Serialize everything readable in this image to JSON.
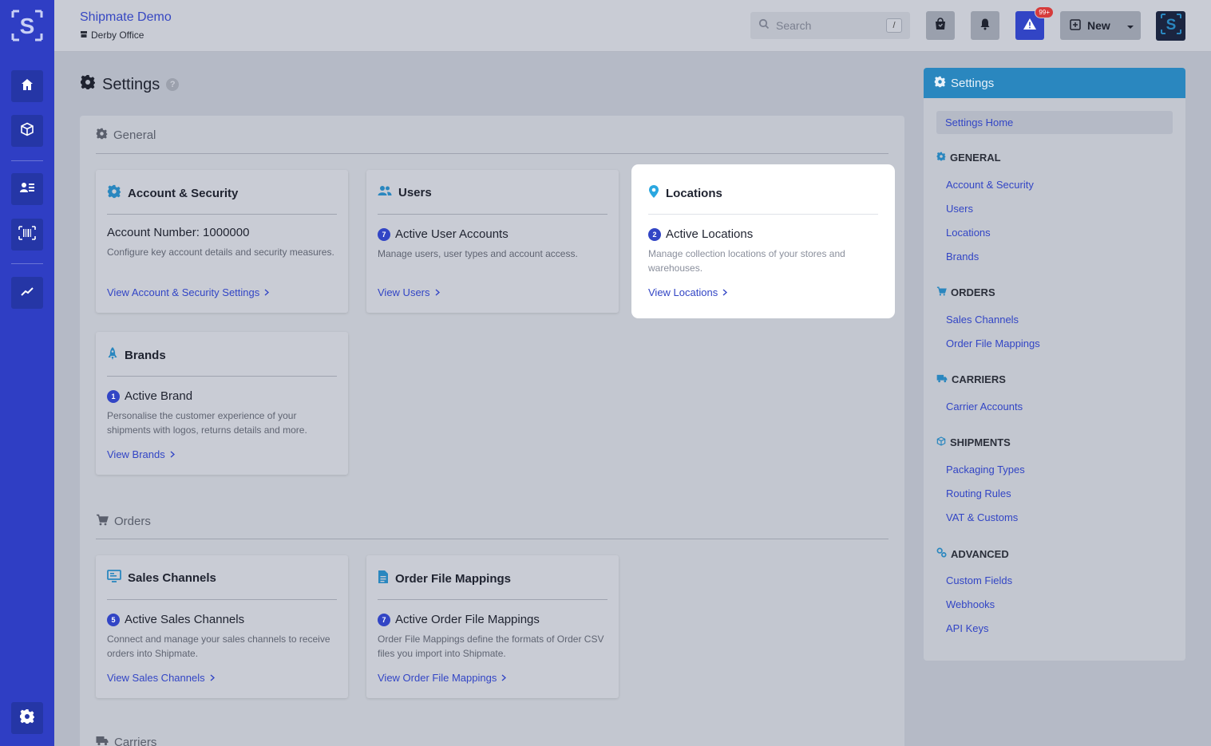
{
  "app": {
    "org_name": "Shipmate Demo",
    "office": "Derby Office"
  },
  "search": {
    "placeholder": "Search",
    "shortcut": "/"
  },
  "topbar": {
    "alerts_badge": "99+",
    "new_label": "New"
  },
  "page": {
    "title": "Settings"
  },
  "sections": {
    "general": "General",
    "orders": "Orders",
    "carriers": "Carriers"
  },
  "cards": {
    "account": {
      "title": "Account & Security",
      "subtitle": "Account Number: 1000000",
      "description": "Configure key account details and security measures.",
      "link": "View Account & Security Settings"
    },
    "users": {
      "title": "Users",
      "count": "7",
      "subtitle": "Active User Accounts",
      "description": "Manage users, user types and account access.",
      "link": "View Users"
    },
    "locations": {
      "title": "Locations",
      "count": "2",
      "subtitle": "Active Locations",
      "description": "Manage collection locations of your stores and warehouses.",
      "link": "View Locations"
    },
    "brands": {
      "title": "Brands",
      "count": "1",
      "subtitle": "Active Brand",
      "description": "Personalise the customer experience of your shipments with logos, returns details and more.",
      "link": "View Brands"
    },
    "sales_channels": {
      "title": "Sales Channels",
      "count": "5",
      "subtitle": "Active Sales Channels",
      "description": "Connect and manage your sales channels to receive orders into Shipmate.",
      "link": "View Sales Channels"
    },
    "order_file_mappings": {
      "title": "Order File Mappings",
      "count": "7",
      "subtitle": "Active Order File Mappings",
      "description": "Order File Mappings define the formats of Order CSV files you import into Shipmate.",
      "link": "View Order File Mappings"
    }
  },
  "sidebar": {
    "title": "Settings",
    "home": "Settings Home",
    "general": {
      "heading": "GENERAL",
      "items": [
        "Account & Security",
        "Users",
        "Locations",
        "Brands"
      ]
    },
    "orders": {
      "heading": "ORDERS",
      "items": [
        "Sales Channels",
        "Order File Mappings"
      ]
    },
    "carriers": {
      "heading": "CARRIERS",
      "items": [
        "Carrier Accounts"
      ]
    },
    "shipments": {
      "heading": "SHIPMENTS",
      "items": [
        "Packaging Types",
        "Routing Rules",
        "VAT & Customs"
      ]
    },
    "advanced": {
      "heading": "ADVANCED",
      "items": [
        "Custom Fields",
        "Webhooks",
        "API Keys"
      ]
    }
  },
  "colors": {
    "rail": "#2f3ec4",
    "accent": "#3245c5",
    "settings_header": "#2a87bf",
    "icon_blue": "#2a87bf"
  }
}
